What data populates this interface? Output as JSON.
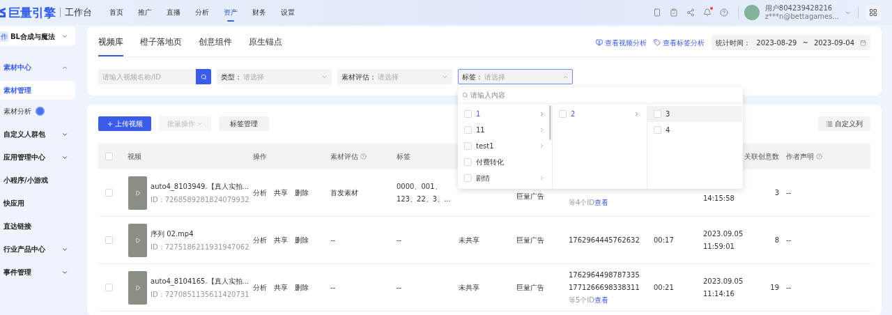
{
  "header": {
    "logo": "巨量引擎",
    "workspace": "工作台",
    "nav": [
      {
        "label": "首页",
        "selected": false
      },
      {
        "label": "推广",
        "selected": false
      },
      {
        "label": "直播",
        "selected": false
      },
      {
        "label": "分析",
        "selected": false
      },
      {
        "label": "资产",
        "selected": true
      },
      {
        "label": "财务",
        "selected": false
      },
      {
        "label": "设置",
        "selected": false
      }
    ],
    "notification_dot": true,
    "user_name": "用户804239428216",
    "user_email": "z***n@bettagames..."
  },
  "sidebar": {
    "account": {
      "badge": "作",
      "name": "BL合成与魔法"
    },
    "items": [
      {
        "label": "素材中心",
        "kind": "group",
        "expanded": true,
        "children": [
          {
            "label": "素材管理",
            "kind": "page",
            "selected": true
          },
          {
            "label": "素材分析",
            "kind": "tool",
            "selected": false
          }
        ]
      },
      {
        "label": "自定义人群包",
        "kind": "group",
        "expanded": false
      },
      {
        "label": "应用管理中心",
        "kind": "group",
        "expanded": false
      },
      {
        "label": "小程序/小游戏",
        "kind": "link"
      },
      {
        "label": "快应用",
        "kind": "link"
      },
      {
        "label": "直达链接",
        "kind": "link"
      },
      {
        "label": "行业产品中心",
        "kind": "group",
        "expanded": false
      },
      {
        "label": "事件管理",
        "kind": "group",
        "expanded": false
      }
    ]
  },
  "tabs": [
    {
      "label": "视频库",
      "selected": true
    },
    {
      "label": "橙子落地页",
      "selected": false
    },
    {
      "label": "创意组件",
      "selected": false
    },
    {
      "label": "原生锚点",
      "selected": false
    }
  ],
  "links": [
    "查看视频分析",
    "查看标签分析"
  ],
  "date_range": {
    "label": "统计时间：",
    "start": "2023-08-29",
    "separator": "~",
    "end": "2023-09-04"
  },
  "filters": {
    "search_placeholder": "请输入视频名称/ID",
    "selects": [
      {
        "label": "类型：",
        "placeholder": "请选择",
        "open": false
      },
      {
        "label": "素材评估：",
        "placeholder": "请选择",
        "open": false
      },
      {
        "label": "标签：",
        "placeholder": "请选择",
        "open": true
      }
    ]
  },
  "tag_dropdown": {
    "search_placeholder": "请输入内容",
    "columns": [
      [
        {
          "label": "1",
          "checked": false,
          "active": true,
          "highlighted": false,
          "has_children": true
        },
        {
          "label": "11",
          "checked": false,
          "active": false,
          "highlighted": false,
          "has_children": true
        },
        {
          "label": "test1",
          "checked": false,
          "active": false,
          "highlighted": false,
          "has_children": true
        },
        {
          "label": "付费转化",
          "checked": false,
          "active": false,
          "highlighted": false,
          "has_children": false
        },
        {
          "label": "剧情",
          "checked": false,
          "active": false,
          "highlighted": false,
          "has_children": true
        }
      ],
      [
        {
          "label": "2",
          "checked": false,
          "active": true,
          "highlighted": false,
          "has_children": true
        }
      ],
      [
        {
          "label": "3",
          "checked": false,
          "active": false,
          "highlighted": true,
          "has_children": false
        },
        {
          "label": "4",
          "checked": false,
          "active": false,
          "highlighted": false,
          "has_children": false
        }
      ]
    ]
  },
  "toolbar": {
    "upload": "上传视频",
    "batch": {
      "label": "批量操作",
      "disabled": true
    },
    "tag_manage": "标签管理",
    "custom_columns": "自定义列"
  },
  "table": {
    "all_checked": false,
    "columns": [
      {
        "label": "视频"
      },
      {
        "label": "操作"
      },
      {
        "label": "素材评估",
        "help": true
      },
      {
        "label": "标签"
      },
      {},
      {},
      {},
      {},
      {},
      {
        "label": "关联创意数"
      },
      {
        "label": "作者声明",
        "help": true
      }
    ],
    "rows": [
      {
        "checked": false,
        "title": "auto4_8103949.【真人实拍...",
        "id": "ID：7268589281824079932",
        "actions": [
          "分析",
          "共享",
          "删除"
        ],
        "evaluation": "首发素材",
        "tags": [
          "0000、001、",
          "123、22、3、..."
        ],
        "source": "巨量广告",
        "more_ids": {
          "text": "等4个ID",
          "link": "查看"
        },
        "time": [
          "14:15:58"
        ],
        "count": "3",
        "author": "--"
      },
      {
        "checked": false,
        "title": "序列 02.mp4",
        "id": "ID：7275186211931947062",
        "actions": [
          "分析",
          "共享",
          "删除"
        ],
        "evaluation": "--",
        "tags": [
          "--"
        ],
        "share": "未共享",
        "source": "巨量广告",
        "ids": [
          "1762964445762632"
        ],
        "duration": "00:17",
        "time": [
          "2023.09.05",
          "11:59:01"
        ],
        "count": "8",
        "author": "--"
      },
      {
        "checked": false,
        "title": "auto4_8104165.【真人实拍...",
        "id": "ID：7270851135611420731",
        "actions": [
          "分析",
          "共享",
          "删除"
        ],
        "evaluation": "--",
        "tags": [
          "--"
        ],
        "share": "未共享",
        "source": "巨量广告",
        "ids": [
          "1762964498787335",
          "1771266698338311"
        ],
        "more_ids": {
          "text": "等5个ID",
          "link": "查看"
        },
        "duration": "00:21",
        "time": [
          "2023.09.05",
          "11:14:16"
        ],
        "count": "19",
        "author": "--"
      }
    ]
  }
}
